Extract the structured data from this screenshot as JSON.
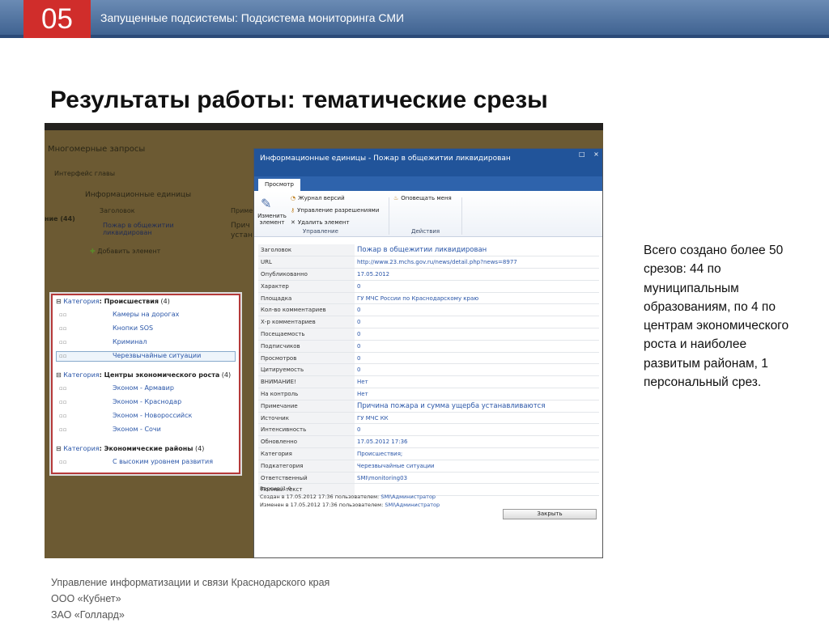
{
  "slide": {
    "number": "05",
    "header_title": "Запущенные подсистемы: Подсистема мониторинга СМИ",
    "heading": "Результаты работы: тематические срезы",
    "side_text": "Всего создано более 50 срезов: 44 по муниципальным образованиям, по 4 по центрам экономического роста и наиболее развитым районам, 1 персональный срез.",
    "footer": [
      "Управление информатизации и связи Краснодарского края",
      "ООО «Кубнет»",
      "ЗАО «Голлард»"
    ]
  },
  "background_page": {
    "nav_title": "Многомерные запросы",
    "subnav": "Интерфейс главы",
    "list_title": "Информационные единицы",
    "col_header": "Заголовок",
    "col_header2": "Приме",
    "count_label": "ние (44)",
    "item_title": "Пожар в общежитии ликвидирован",
    "item_note": "Прич",
    "item_note2": "устан",
    "add_item": "Добавить элемент"
  },
  "categories_panel": {
    "groups": [
      {
        "prefix": "Категория",
        "name": ": Происшествия",
        "count": "(4)",
        "items": [
          "Камеры на дорогах",
          "Кнопки SOS",
          "Криминал",
          "Черезвычайные ситуации"
        ]
      },
      {
        "prefix": "Категория",
        "name": ": Центры экономического роста",
        "count": "(4)",
        "items": [
          "Эконом - Армавир",
          "Эконом - Краснодар",
          "Эконом - Новороссийск",
          "Эконом - Сочи"
        ]
      },
      {
        "prefix": "Категория",
        "name": ": Экономические районы",
        "count": "(4)",
        "items": [
          "С высоким уровнем развития"
        ]
      }
    ]
  },
  "dialog": {
    "title": "Информационные единицы - Пожар в общежитии ликвидирован",
    "window_buttons": "□ ×",
    "tab": "Просмотр",
    "ribbon": {
      "edit_label": "Изменить элемент",
      "version_log": "Журнал версий",
      "permissions": "Управление разрешениями",
      "delete": "Удалить элемент",
      "notify": "Оповещать меня",
      "group_manage": "Управление",
      "group_actions": "Действия"
    },
    "properties": [
      {
        "label": "Заголовок",
        "value": "Пожар в общежитии ликвидирован"
      },
      {
        "label": "URL",
        "value": "http://www.23.mchs.gov.ru/news/detail.php?news=8977"
      },
      {
        "label": "Опубликованно",
        "value": "17.05.2012"
      },
      {
        "label": "Характер",
        "value": "0"
      },
      {
        "label": "Площадка",
        "value": "ГУ МЧС России по Краснодарскому краю"
      },
      {
        "label": "Кол-во комментариев",
        "value": "0"
      },
      {
        "label": "Х-р комментариев",
        "value": "0"
      },
      {
        "label": "Посещаемость",
        "value": "0"
      },
      {
        "label": "Подписчиков",
        "value": "0"
      },
      {
        "label": "Просмотров",
        "value": "0"
      },
      {
        "label": "Цитируемость",
        "value": "0"
      },
      {
        "label": "ВНИМАНИЕ!",
        "value": "Нет"
      },
      {
        "label": "На контроль",
        "value": "Нет"
      },
      {
        "label": "Примечание",
        "value": "Причина пожара и сумма ущерба устанавливаются"
      },
      {
        "label": "Источник",
        "value": "ГУ МЧС КК"
      },
      {
        "label": "Интенсивность",
        "value": "0"
      },
      {
        "label": "Обновленно",
        "value": "17.05.2012 17:36"
      },
      {
        "label": "Категория",
        "value": "Происшествия;"
      },
      {
        "label": "Подкатегория",
        "value": "Черезвычайные ситуации"
      },
      {
        "label": "Ответственный",
        "value": "SMI\\monitoring03"
      },
      {
        "label": "Полный текст",
        "value": ""
      }
    ],
    "version": "Версия: 1.0",
    "created": "Создан в 17.05.2012 17:36 пользователем:",
    "created_user": "SMI\\Администратор",
    "modified": "Изменен в 17.05.2012 17:36 пользователем:",
    "modified_user": "SMI\\Администратор",
    "close_button": "Закрыть"
  }
}
